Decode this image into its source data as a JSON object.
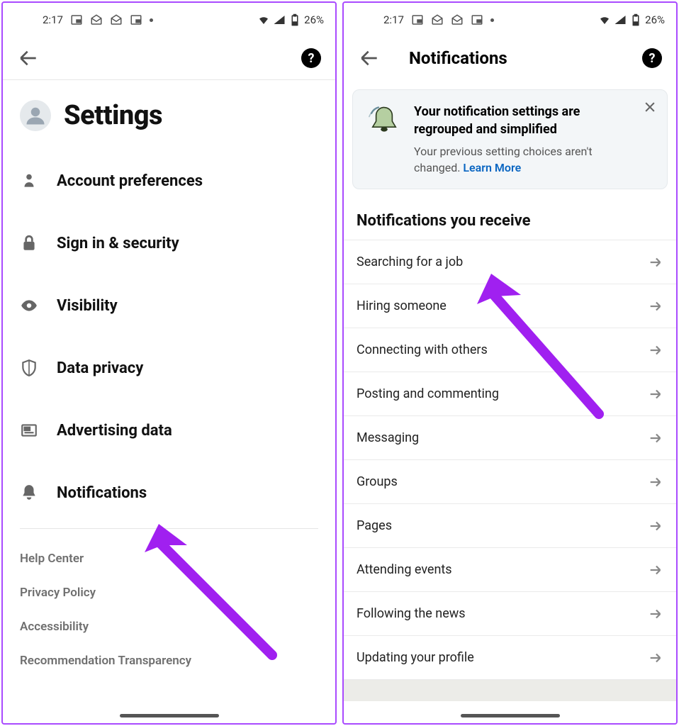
{
  "status": {
    "time": "2:17",
    "battery": "26%"
  },
  "left": {
    "title": "Settings",
    "items": [
      {
        "label": "Account preferences"
      },
      {
        "label": "Sign in & security"
      },
      {
        "label": "Visibility"
      },
      {
        "label": "Data privacy"
      },
      {
        "label": "Advertising data"
      },
      {
        "label": "Notifications"
      }
    ],
    "footer": [
      "Help Center",
      "Privacy Policy",
      "Accessibility",
      "Recommendation Transparency"
    ]
  },
  "right": {
    "title": "Notifications",
    "banner": {
      "title": "Your notification settings are regrouped and simplified",
      "subtitle": "Your previous setting choices aren't changed. ",
      "link": "Learn More"
    },
    "section": "Notifications you receive",
    "items": [
      "Searching for a job",
      "Hiring someone",
      "Connecting with others",
      "Posting and commenting",
      "Messaging",
      "Groups",
      "Pages",
      "Attending events",
      "Following the news",
      "Updating your profile"
    ]
  }
}
